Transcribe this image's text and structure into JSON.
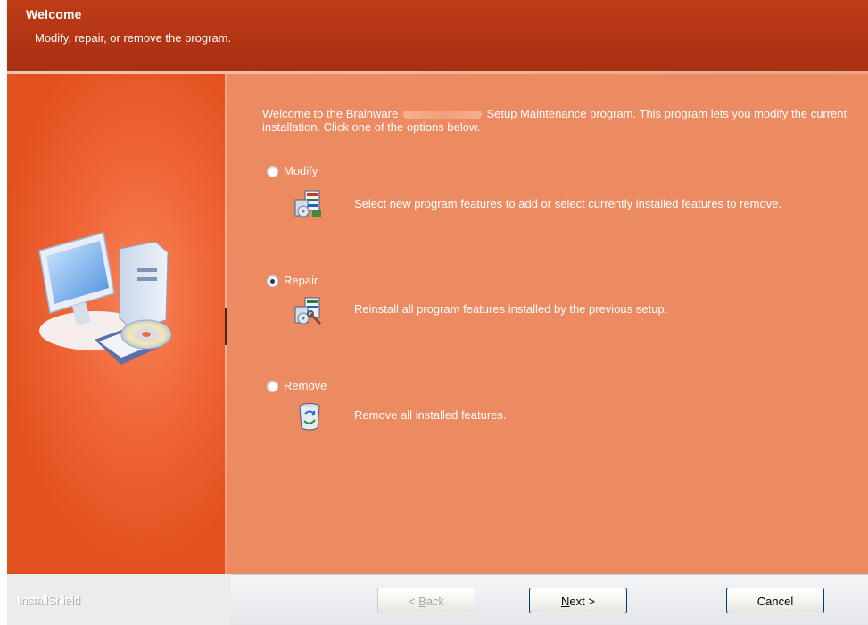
{
  "header": {
    "title": "Welcome",
    "subtitle": "Modify, repair, or remove the program."
  },
  "main": {
    "intro_prefix": "Welcome to the Brainware",
    "intro_suffix": "Setup Maintenance program. This program lets you modify the current installation. Click one of the options below.",
    "options": [
      {
        "label": "Modify",
        "description": "Select new program features to add or select currently installed features to remove.",
        "selected": false,
        "icon": "modify-program-icon"
      },
      {
        "label": "Repair",
        "description": "Reinstall all program features installed by the previous setup.",
        "selected": true,
        "icon": "repair-program-icon"
      },
      {
        "label": "Remove",
        "description": "Remove all installed features.",
        "selected": false,
        "icon": "recycle-bin-icon"
      }
    ]
  },
  "left_panel": {
    "illustration": "computer-with-cd-icon"
  },
  "footer": {
    "brand": "InstallShield",
    "back_pre": "< ",
    "back_key": "B",
    "back_rest": "ack",
    "next_key": "N",
    "next_rest": "ext >",
    "cancel_label": "Cancel"
  },
  "colors": {
    "header": "#b23414",
    "content": "#ec8a62",
    "left_panel": "#ef6334"
  }
}
